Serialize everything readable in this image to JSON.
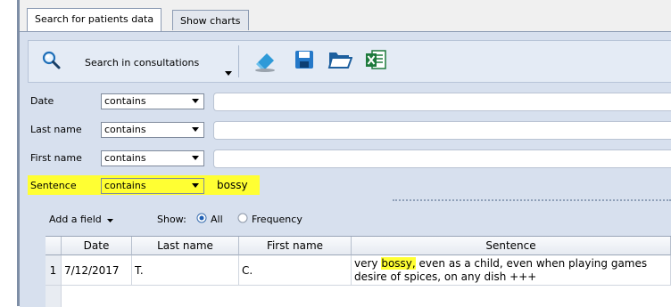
{
  "tabs": [
    {
      "label": "Search for patients data",
      "active": true
    },
    {
      "label": "Show charts",
      "active": false
    }
  ],
  "toolbar": {
    "search_label": "Search in consultations",
    "icons": [
      "magnifier-icon",
      "dropdown-chevron-icon",
      "eraser-icon",
      "save-icon",
      "open-folder-icon",
      "excel-icon"
    ]
  },
  "filters": [
    {
      "label": "Date",
      "operator": "contains",
      "value": ""
    },
    {
      "label": "Last name",
      "operator": "contains",
      "value": ""
    },
    {
      "label": "First name",
      "operator": "contains",
      "value": ""
    },
    {
      "label": "Sentence",
      "operator": "contains",
      "value": "bossy",
      "highlighted": true
    }
  ],
  "options": {
    "add_field_label": "Add a field",
    "show_label": "Show:",
    "all_label": "All",
    "frequency_label": "Frequency",
    "selected": "All"
  },
  "table": {
    "columns": [
      "Date",
      "Last name",
      "First name",
      "Sentence"
    ],
    "rows": [
      {
        "num": "1",
        "date": "7/12/2017",
        "last_name": "T.",
        "first_name": "C.",
        "sentence_pre": "very ",
        "sentence_hl": "bossy,",
        "sentence_post": " even as a child, even when playing games",
        "sentence_line2": "desire of spices, on any dish +++"
      }
    ]
  },
  "colors": {
    "highlight": "#ffff33",
    "panel": "#d7e0ee",
    "toolbar": "#e4ebf5"
  }
}
